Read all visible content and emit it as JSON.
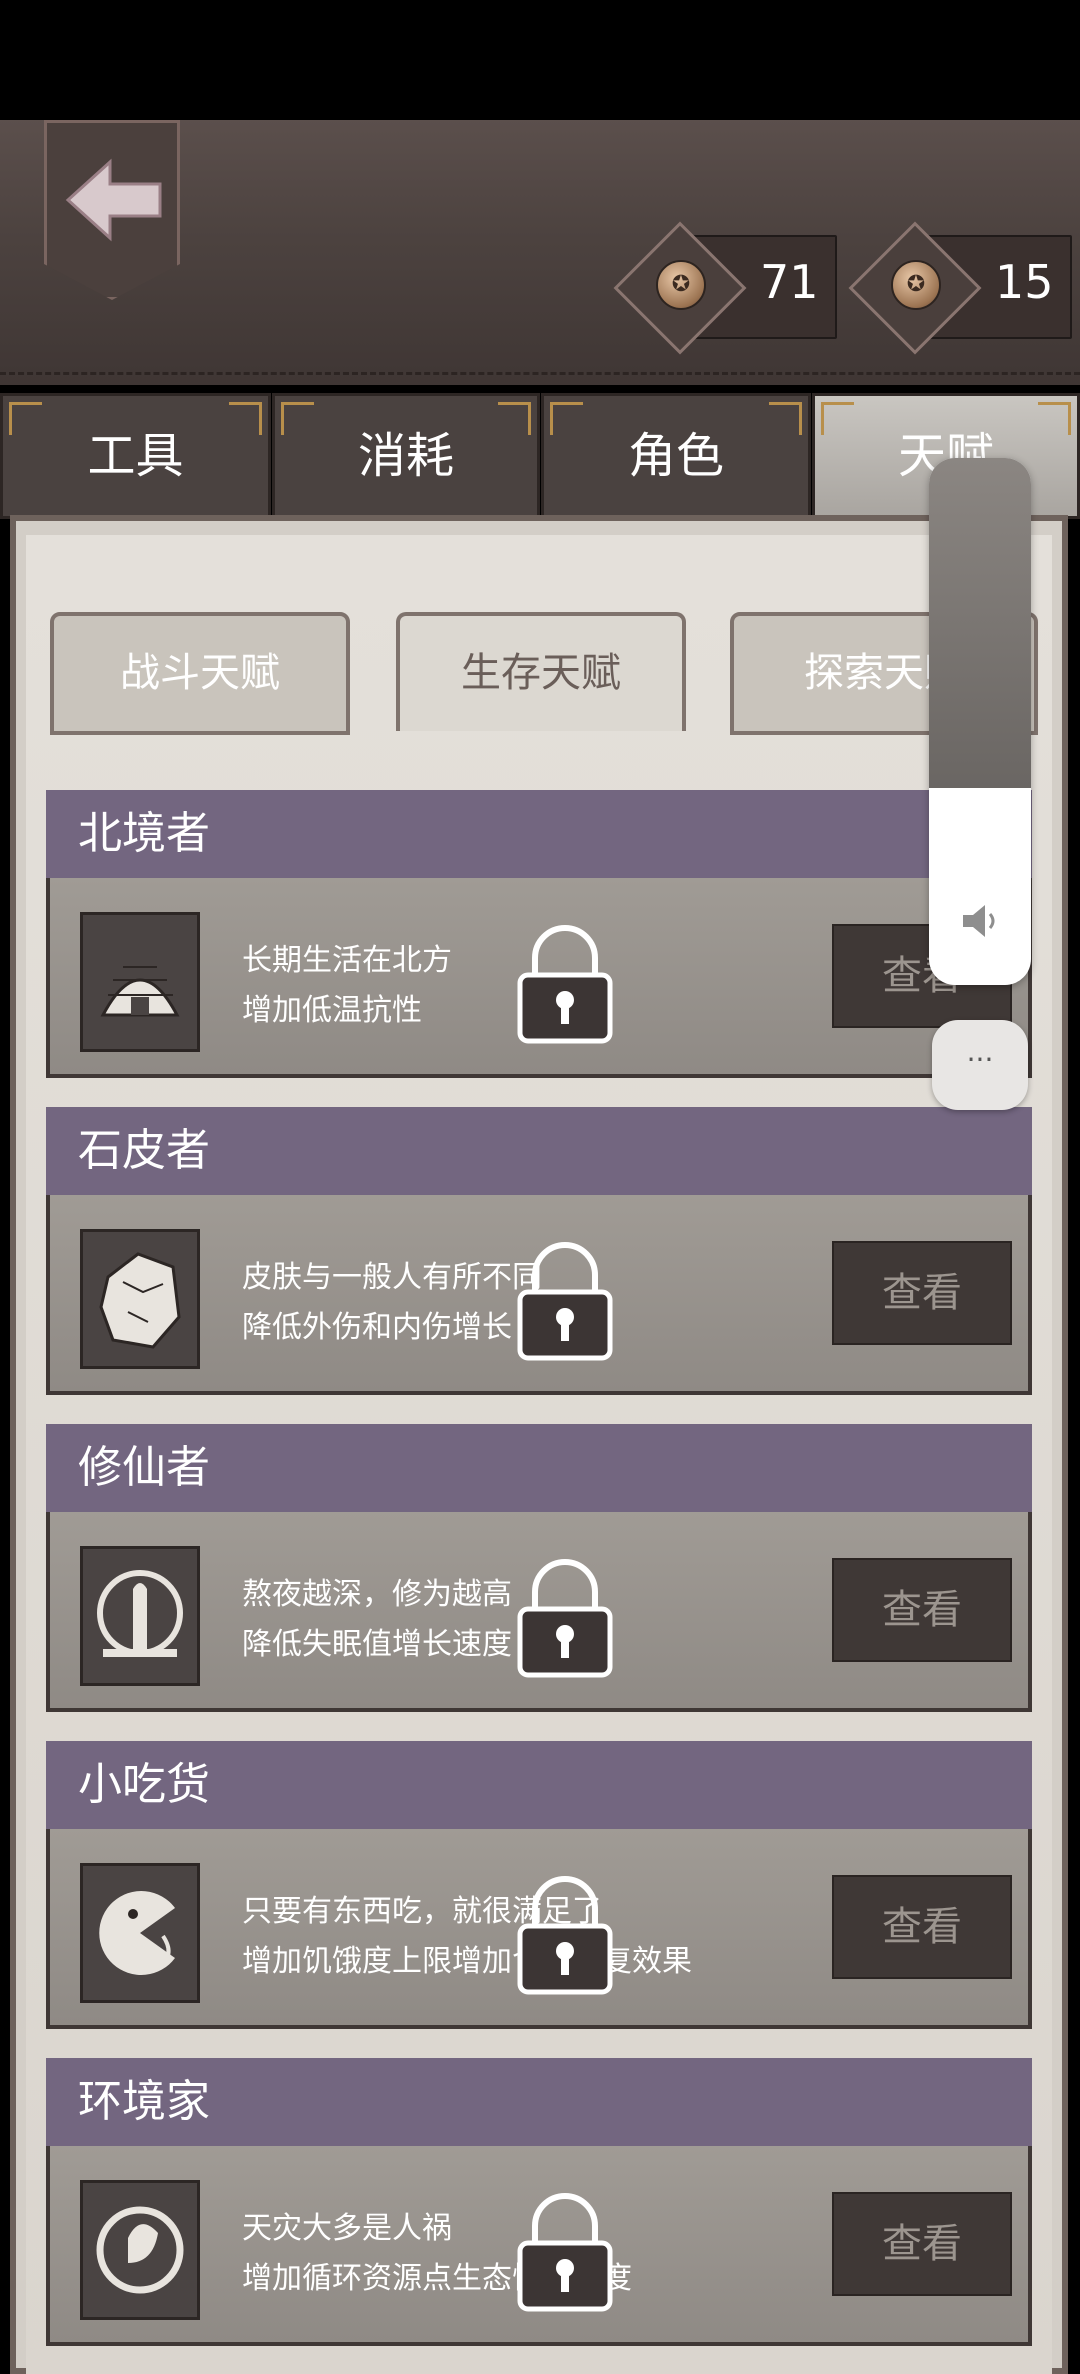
{
  "header": {
    "currency_1": {
      "value": "71",
      "icon": "coin-icon"
    },
    "currency_2": {
      "value": "15",
      "icon": "coin-icon"
    }
  },
  "tabs": [
    {
      "label": "工具"
    },
    {
      "label": "消耗"
    },
    {
      "label": "角色"
    },
    {
      "label": "天赋"
    }
  ],
  "subtabs": [
    {
      "label": "战斗天赋"
    },
    {
      "label": "生存天赋"
    },
    {
      "label": "探索天赋"
    }
  ],
  "talents": [
    {
      "name": "北境者",
      "line1": "长期生活在北方",
      "line2": "增加低温抗性",
      "icon": "igloo-icon",
      "button": "查看"
    },
    {
      "name": "石皮者",
      "line1": "皮肤与一般人有所不同",
      "line2": "降低外伤和内伤增长",
      "icon": "rock-icon",
      "button": "查看"
    },
    {
      "name": "修仙者",
      "line1": "熬夜越深，修为越高",
      "line2": "降低失眠值增长速度",
      "icon": "praying-hands-icon",
      "button": "查看"
    },
    {
      "name": "小吃货",
      "line1": "只要有东西吃，就很满足了",
      "line2": "增加饥饿度上限增加食物恢复效果",
      "icon": "pacman-icon",
      "button": "查看"
    },
    {
      "name": "环境家",
      "line1": "天灾大多是人祸",
      "line2": "增加循环资源点生态恢复速度",
      "icon": "leaf-cycle-icon",
      "button": "查看"
    }
  ],
  "overlay": {
    "volume_level": 0.37,
    "more_label": "···"
  },
  "colors": {
    "header_purple": "#736680",
    "leather": "#4c423f",
    "paper": "#dad5ce"
  }
}
